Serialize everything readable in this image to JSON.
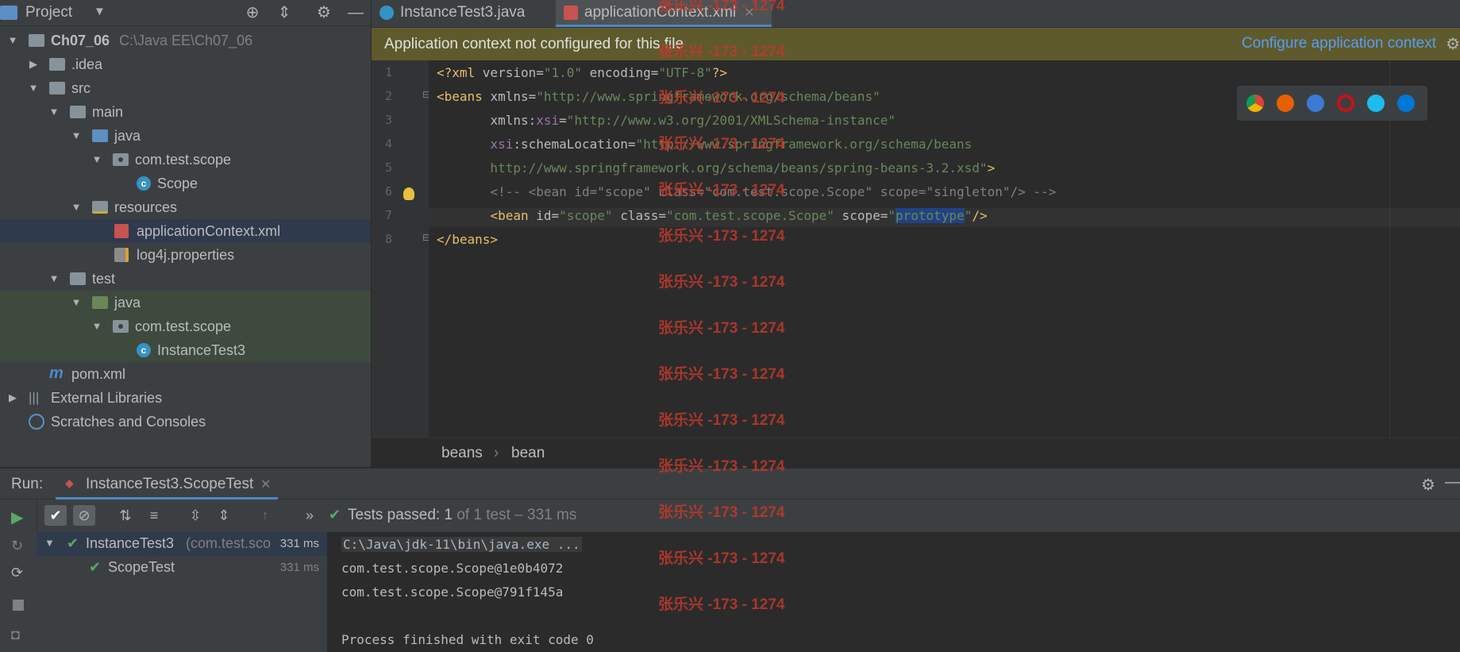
{
  "project": {
    "title": "Project",
    "tree": [
      {
        "label": "Ch07_06",
        "suffix": "C:\\Java EE\\Ch07_06"
      },
      {
        "label": ".idea"
      },
      {
        "label": "src"
      },
      {
        "label": "main"
      },
      {
        "label": "java"
      },
      {
        "label": "com.test.scope"
      },
      {
        "label": "Scope"
      },
      {
        "label": "resources"
      },
      {
        "label": "applicationContext.xml"
      },
      {
        "label": "log4j.properties"
      },
      {
        "label": "test"
      },
      {
        "label": "java"
      },
      {
        "label": "com.test.scope"
      },
      {
        "label": "InstanceTest3"
      },
      {
        "label": "pom.xml"
      },
      {
        "label": "External Libraries"
      },
      {
        "label": "Scratches and Consoles"
      }
    ]
  },
  "tabs": [
    {
      "label": "InstanceTest3.java"
    },
    {
      "label": "applicationContext.xml"
    }
  ],
  "banner": {
    "text": "Application context not configured for this file",
    "link": "Configure application context"
  },
  "editor": {
    "line_numbers": [
      "1",
      "2",
      "3",
      "4",
      "5",
      "6",
      "7",
      "8"
    ],
    "breadcrumb": [
      "beans",
      "bean"
    ]
  },
  "run": {
    "label": "Run:",
    "config_tab": "InstanceTest3.ScopeTest",
    "status_prefix": "Tests passed:",
    "status_count": "1",
    "status_suffix": "of 1 test – 331 ms",
    "tests": [
      {
        "label": "InstanceTest3",
        "detail": "(com.test.sco",
        "time": "331 ms"
      },
      {
        "label": "ScopeTest",
        "time": "331 ms"
      }
    ],
    "console": [
      "C:\\Java\\jdk-11\\bin\\java.exe ...",
      "com.test.scope.Scope@1e0b4072",
      "com.test.scope.Scope@791f145a",
      "",
      "Process finished with exit code 0"
    ]
  },
  "watermark": "张乐兴 -173 - 1274",
  "colors": {
    "accent": "#4a88c7",
    "banner": "#5f5a2c",
    "pass": "#59a869",
    "watermark": "#c0392b"
  }
}
